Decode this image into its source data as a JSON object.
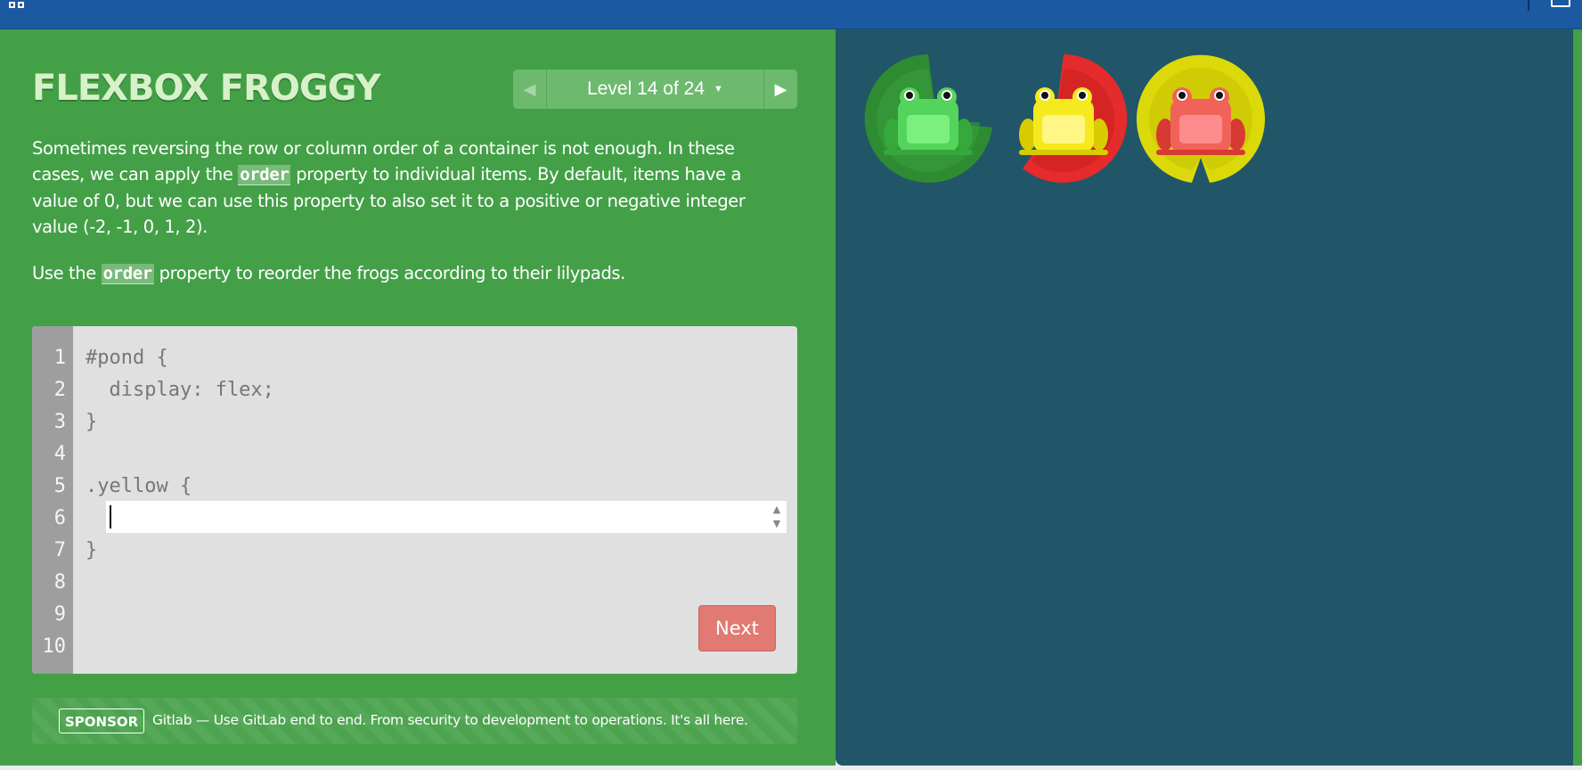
{
  "title": "FLEXBOX FROGGY",
  "level": {
    "label": "Level 14 of 24",
    "prev_icon": "triangle-left",
    "next_icon": "triangle-right",
    "dropdown_icon": "caret-down"
  },
  "instructions": {
    "p1_a": "Sometimes reversing the row or column order of a container is not enough. In these cases, we can apply the ",
    "p1_code": "order",
    "p1_b": " property to individual items. By default, items have a value of 0, but we can use this property to also set it to a positive or negative integer value (-2, -1, 0, 1, 2).",
    "p2_a": "Use the ",
    "p2_code": "order",
    "p2_b": " property to reorder the frogs according to their lilypads."
  },
  "editor": {
    "line_numbers": "1\n2\n3\n4\n5\n6\n7\n8\n9\n10",
    "code_before": "#pond {\n  display: flex;\n}\n\n.yellow {",
    "code_after": "}",
    "input_value": "",
    "next_label": "Next"
  },
  "sponsor": {
    "badge": "SPONSOR",
    "text": "Gitlab — Use GitLab end to end. From security to development to operations. It's all here."
  },
  "pond": {
    "lilypads": [
      {
        "color": "green",
        "pad_fill": "#2e8b32",
        "pad_shade": "#237a27"
      },
      {
        "color": "red",
        "pad_fill": "#e52b2b",
        "pad_shade": "#c41e1e"
      },
      {
        "color": "yellow",
        "pad_fill": "#dcd90a",
        "pad_shade": "#c4c000"
      }
    ],
    "frogs": [
      {
        "color": "green",
        "body": "#54d45b",
        "belly": "#7cf07f",
        "dark": "#36a83c"
      },
      {
        "color": "yellow",
        "body": "#f5ea1e",
        "belly": "#fff685",
        "dark": "#d8cc00"
      },
      {
        "color": "red",
        "body": "#f0625a",
        "belly": "#ff8c8c",
        "dark": "#d63a32"
      }
    ]
  },
  "colors": {
    "topbar": "#1b5aa0",
    "panel_green": "#43a047",
    "pond_bg": "#215668",
    "next_button": "#e07a72"
  }
}
